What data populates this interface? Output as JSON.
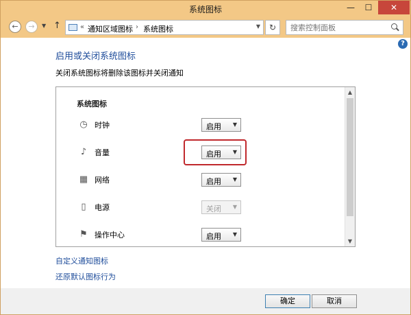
{
  "window": {
    "title": "系统图标",
    "minimize_glyph": "—",
    "maximize_glyph": "☐",
    "close_glyph": "✕"
  },
  "nav": {
    "back_glyph": "←",
    "forward_glyph": "→",
    "dropdown_glyph": "▼",
    "up_glyph": "↑",
    "address_prefix": "«",
    "address_segments": [
      "通知区域图标",
      "系统图标"
    ],
    "address_separator": "›",
    "refresh_glyph": "↻",
    "search_placeholder": "搜索控制面板"
  },
  "content": {
    "help_glyph": "?",
    "title": "启用或关闭系统图标",
    "description": "关闭系统图标将删除该图标并关闭通知",
    "panel": {
      "heading": "系统图标",
      "rows": [
        {
          "label": "时钟",
          "icon": "clock-icon",
          "icon_glyph": "◷",
          "value": "启用",
          "enabled": true
        },
        {
          "label": "音量",
          "icon": "speaker-icon",
          "icon_glyph": "♪",
          "value": "启用",
          "enabled": true
        },
        {
          "label": "网络",
          "icon": "network-icon",
          "icon_glyph": "▦",
          "value": "启用",
          "enabled": true
        },
        {
          "label": "电源",
          "icon": "battery-icon",
          "icon_glyph": "▯",
          "value": "关闭",
          "enabled": false
        },
        {
          "label": "操作中心",
          "icon": "flag-icon",
          "icon_glyph": "⚑",
          "value": "启用",
          "enabled": true
        }
      ],
      "highlighted_row": "音量"
    },
    "links": {
      "customize": "自定义通知图标",
      "restore": "还原默认图标行为"
    }
  },
  "footer": {
    "ok_label": "确定",
    "cancel_label": "取消"
  },
  "colors": {
    "titlebar": "#f3c886",
    "link": "#1f4d9b",
    "highlight": "#c0282c",
    "close_button": "#c7463b"
  }
}
